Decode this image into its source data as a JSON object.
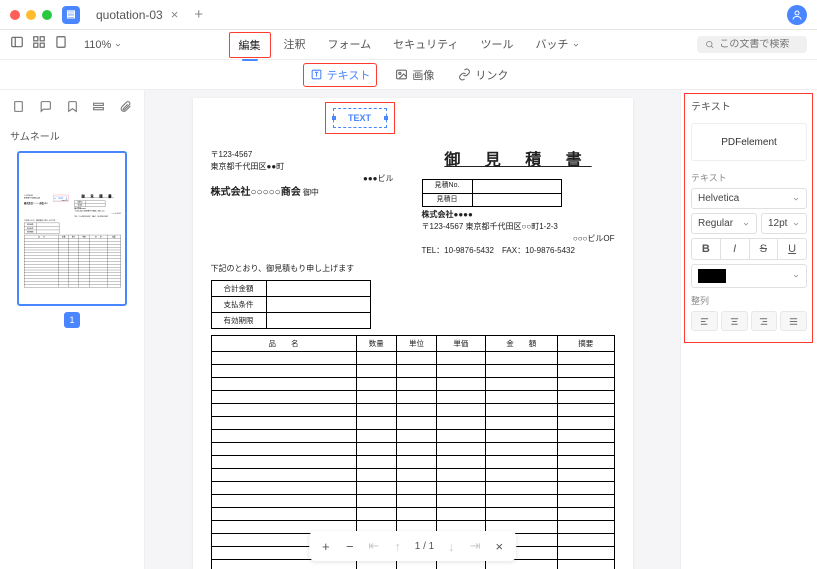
{
  "title": "quotation-03",
  "zoom": "110%",
  "search_placeholder": "この文書で検索",
  "menu": {
    "edit": "編集",
    "annotate": "注釈",
    "form": "フォーム",
    "security": "セキュリティ",
    "tools": "ツール",
    "batch": "バッチ"
  },
  "sub": {
    "text": "テキスト",
    "image": "画像",
    "link": "リンク"
  },
  "left": {
    "label": "サムネール",
    "page_badge": "1"
  },
  "overlay_text": "TEXT",
  "doc": {
    "postal": "〒123-4567",
    "prefecture": "東京都千代田区●●町",
    "building": "●●●ビル",
    "company": "株式会社○○○○○商会",
    "attn": "御中",
    "title": "御 見 積 書",
    "mini_rows": [
      "見積No.",
      "見積日"
    ],
    "right_company": "株式会社●●●●",
    "right_postal": "〒123-4567",
    "right_addr": "東京都千代田区○○町1-2-3",
    "right_of": "○○○ビルOF",
    "right_tel": "TEL：10-9876-5432　FAX：10-9876-5432",
    "note": "下記のとおり、御見積もり申し上げます",
    "sum_rows": [
      "合計金額",
      "支払条件",
      "有効期限"
    ],
    "cols": [
      "品　　名",
      "数量",
      "単位",
      "単価",
      "金　　額",
      "摘要"
    ]
  },
  "paginator": {
    "cur": "1",
    "sep": "/",
    "tot": "1"
  },
  "rp": {
    "header": "テキスト",
    "preview": "PDFelement",
    "label_text": "テキスト",
    "font": "Helvetica",
    "weight": "Regular",
    "size": "12pt",
    "bold": "B",
    "italic": "I",
    "strike": "S",
    "underline": "U",
    "label_align": "整列"
  }
}
